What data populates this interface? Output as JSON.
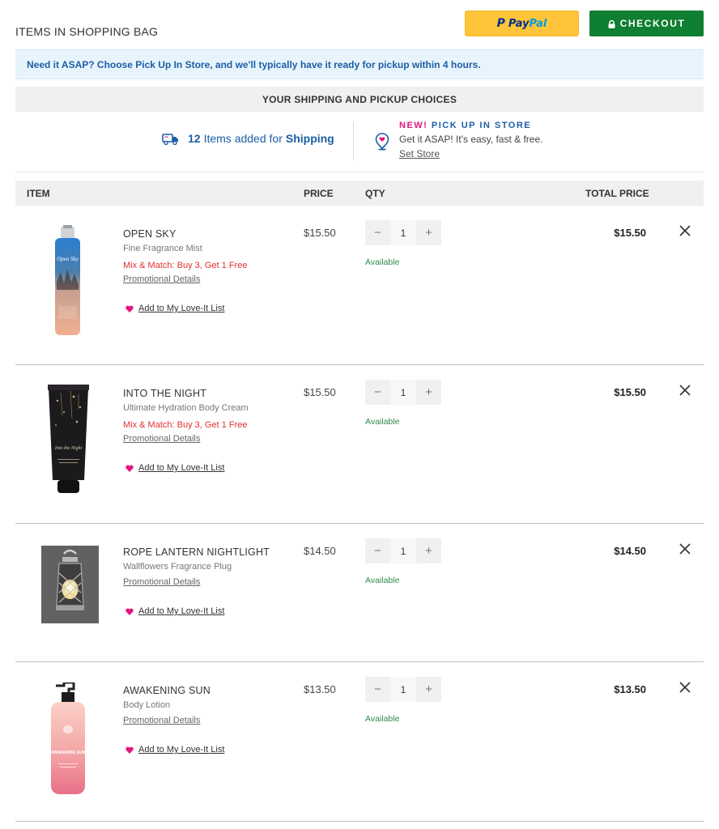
{
  "header": {
    "title": "ITEMS IN SHOPPING BAG",
    "paypal_a": "Pay",
    "paypal_b": "Pal",
    "checkout_label": "CHECKOUT"
  },
  "banner": {
    "text": "Need it ASAP? Choose Pick Up In Store, and we'll typically have it ready for pickup within 4 hours."
  },
  "choices": {
    "title": "YOUR SHIPPING AND PICKUP CHOICES",
    "shipping_count": "12",
    "shipping_text": "Items added for",
    "shipping_word": "Shipping",
    "pickup_new": "NEW!",
    "pickup_title": "PICK UP IN STORE",
    "pickup_sub": "Get it ASAP! It's easy, fast & free.",
    "set_store": "Set Store"
  },
  "columns": {
    "item": "ITEM",
    "price": "PRICE",
    "qty": "QTY",
    "total": "TOTAL PRICE"
  },
  "items": [
    {
      "name": "OPEN SKY",
      "subname": "Fine Fragrance Mist",
      "promo": "Mix & Match: Buy 3, Get 1 Free",
      "promo_link": "Promotional Details",
      "love": "Add to My Love-It List",
      "price": "$15.50",
      "qty": "1",
      "availability": "Available",
      "total": "$15.50",
      "image_label": "Open Sky"
    },
    {
      "name": "INTO THE NIGHT",
      "subname": "Ultimate Hydration Body Cream",
      "promo": "Mix & Match: Buy 3, Get 1 Free",
      "promo_link": "Promotional Details",
      "love": "Add to My Love-It List",
      "price": "$15.50",
      "qty": "1",
      "availability": "Available",
      "total": "$15.50",
      "image_label": "Into the Night"
    },
    {
      "name": "ROPE LANTERN NIGHTLIGHT",
      "subname": "Wallflowers Fragrance Plug",
      "promo_link": "Promotional Details",
      "love": "Add to My Love-It List",
      "price": "$14.50",
      "qty": "1",
      "availability": "Available",
      "total": "$14.50"
    },
    {
      "name": "AWAKENING SUN",
      "subname": "Body Lotion",
      "promo_link": "Promotional Details",
      "love": "Add to My Love-It List",
      "price": "$13.50",
      "qty": "1",
      "availability": "Available",
      "total": "$13.50",
      "image_label": "AWAKENING SUN"
    }
  ],
  "colors": {
    "brand_blue": "#1c5ea6",
    "checkout_green": "#0f7f31",
    "paypal_yellow": "#ffc439",
    "promo_red": "#e0312f",
    "available_green": "#2f8a4a",
    "accent_pink": "#e4157e"
  },
  "icons": [
    "lock-icon",
    "truck-icon",
    "location-pin-icon",
    "heart-icon",
    "minus-icon",
    "plus-icon",
    "close-icon"
  ]
}
